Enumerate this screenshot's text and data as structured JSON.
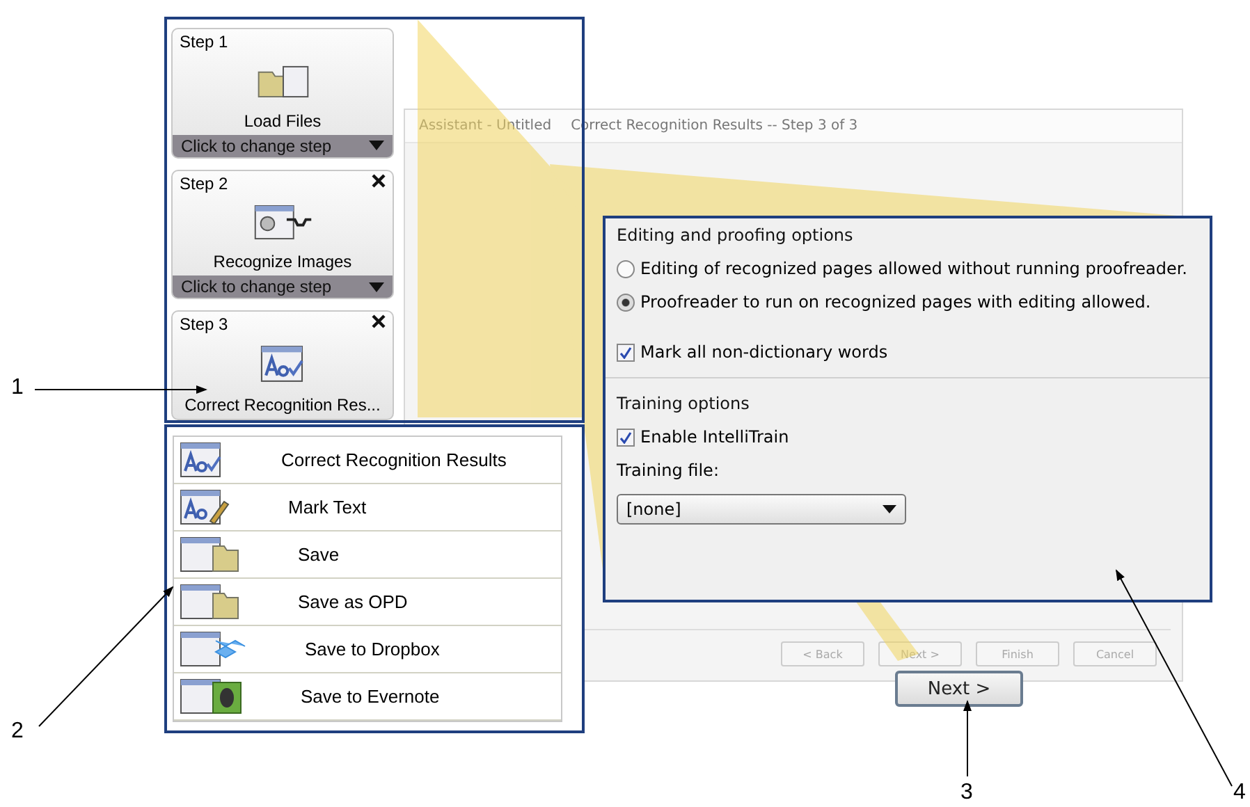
{
  "dialog": {
    "title_prefix": "Assistant - Untitled",
    "title": "Correct Recognition Results -- Step 3 of 3",
    "buttons": [
      "< Back",
      "Next >",
      "Finish",
      "Cancel"
    ]
  },
  "steps": [
    {
      "title": "Step 1",
      "label": "Load Files",
      "kind": "load",
      "closable": false,
      "change_label": "Click to change step"
    },
    {
      "title": "Step 2",
      "label": "Recognize Images",
      "kind": "recognize",
      "closable": true,
      "change_label": "Click to change step"
    },
    {
      "title": "Step 3",
      "label": "Correct Recognition Res...",
      "kind": "correct",
      "closable": true
    }
  ],
  "menu": [
    {
      "label": "Correct Recognition Results",
      "kind": "correct"
    },
    {
      "label": "Mark Text",
      "kind": "mark"
    },
    {
      "label": "Save",
      "kind": "save"
    },
    {
      "label": "Save as OPD",
      "kind": "save"
    },
    {
      "label": "Save to Dropbox",
      "kind": "dropbox"
    },
    {
      "label": "Save to Evernote",
      "kind": "evernote"
    }
  ],
  "options": {
    "editing_title": "Editing and proofing options",
    "radios": [
      {
        "label": "Editing of recognized pages allowed without running proofreader.",
        "selected": false
      },
      {
        "label": "Proofreader to run on recognized pages with editing allowed.",
        "selected": true
      }
    ],
    "mark": {
      "label": "Mark all non-dictionary words",
      "checked": true
    },
    "training_title": "Training options",
    "intellitrain": {
      "label": "Enable IntelliTrain",
      "checked": true
    },
    "file_label": "Training file:",
    "file_value": "[none]"
  },
  "next_button": "Next >",
  "callouts": [
    "1",
    "2",
    "3",
    "4"
  ]
}
